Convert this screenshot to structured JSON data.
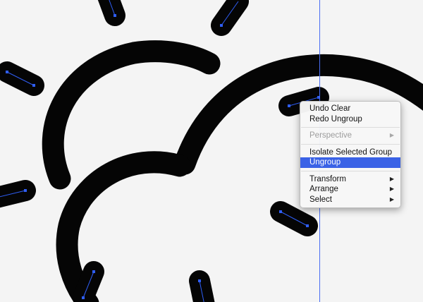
{
  "context_menu": {
    "items": [
      {
        "label": "Undo Clear",
        "enabled": true
      },
      {
        "label": "Redo Ungroup",
        "enabled": true
      },
      {
        "label": "Perspective",
        "enabled": false,
        "submenu_arrow": "▶"
      },
      {
        "label": "Isolate Selected Group",
        "enabled": true
      },
      {
        "label": "Ungroup",
        "enabled": true,
        "highlighted": true
      },
      {
        "label": "Transform",
        "enabled": true,
        "submenu_arrow": "▶"
      },
      {
        "label": "Arrange",
        "enabled": true,
        "submenu_arrow": "▶"
      },
      {
        "label": "Select",
        "enabled": true,
        "submenu_arrow": "▶"
      }
    ]
  },
  "colors": {
    "canvas_background": "#f4f4f4",
    "stroke_black": "#050505",
    "selection_blue": "#2f5ef5",
    "menu_highlight": "#3a62e6"
  },
  "icons": {
    "submenu_arrow": "triangle-right-icon"
  }
}
